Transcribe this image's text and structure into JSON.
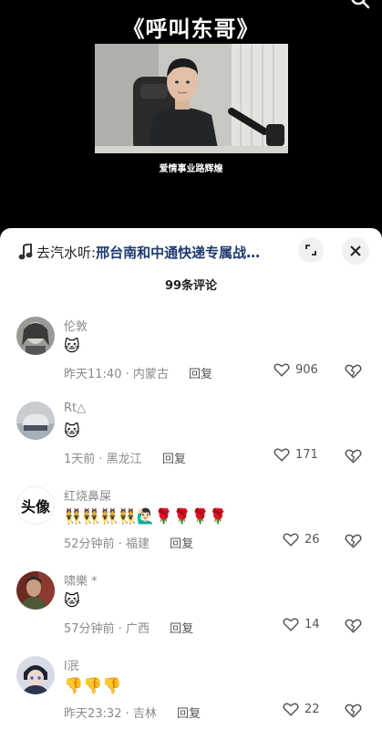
{
  "video": {
    "title": "《呼叫东哥》",
    "subtitle": "爱情事业路辉煌"
  },
  "music": {
    "prefix": "去汽水听: ",
    "title": "邢台南和中通快递专属战…"
  },
  "comments_count": "99条评论",
  "comments": [
    {
      "user": "伦敦",
      "text": "🐱",
      "time_location": "昨天11:40 · 内蒙古",
      "reply": "回复",
      "likes": "906"
    },
    {
      "user": "Rt△",
      "text": "🐱",
      "time_location": "1天前 · 黑龙江",
      "reply": "回复",
      "likes": "171"
    },
    {
      "user": "红烧鼻屎",
      "text": "👯👯👯👯🙋🏻‍♂️🌹🌹🌹🌹",
      "time_location": "52分钟前 · 福建",
      "reply": "回复",
      "likes": "26",
      "avatar_text": "头像"
    },
    {
      "user": "啸樂 *",
      "text": "🐱",
      "time_location": "57分钟前 · 广西",
      "reply": "回复",
      "likes": "14"
    },
    {
      "user": "l泯",
      "text": "👎👎👎",
      "time_location": "昨天23:32 · 吉林",
      "reply": "回复",
      "likes": "22"
    }
  ],
  "icons": {
    "note": "music-note-icon",
    "expand": "expand-icon",
    "close": "close-icon",
    "heart": "heart-icon",
    "dislike": "broken-heart-icon"
  },
  "colors": {
    "music_title": "#1f3a6e",
    "meta": "#8a8a8a",
    "sheet_bg": "#ffffff"
  }
}
